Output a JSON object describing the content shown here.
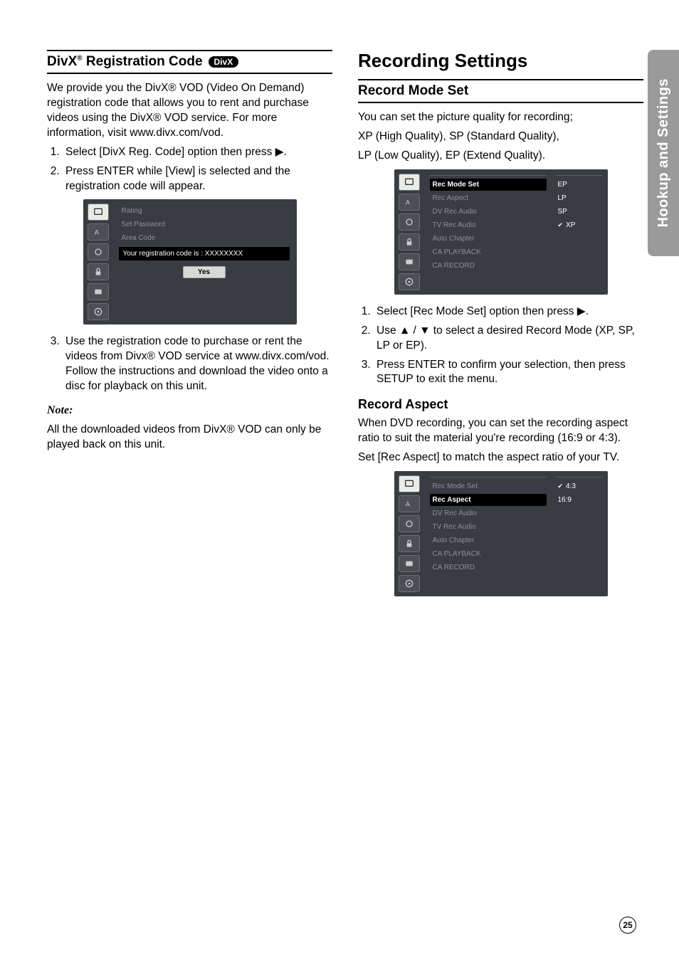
{
  "pageNumber": "25",
  "sideTab": "Hookup and Settings",
  "left": {
    "heading": "DivX® Registration Code",
    "divxBadge": "DivX",
    "intro": "We provide you the DivX® VOD (Video On Demand) registration code that allows you to rent and purchase videos using the DivX® VOD service. For more information, visit www.divx.com/vod.",
    "steps12": {
      "s1": "Select [DivX Reg. Code] option then press ▶.",
      "s2": "Press ENTER while [View] is selected and the registration code will appear."
    },
    "step3": "Use the registration code to purchase or rent the videos from Divx® VOD service at www.divx.com/vod. Follow the instructions and download the video onto a disc for playback on this unit.",
    "noteHead": "Note:",
    "noteBody": "All the downloaded videos from DivX® VOD can only be played back on this unit.",
    "menu": {
      "items": [
        "Rating",
        "Set Password",
        "Area Code"
      ],
      "regLine": "Your registration code is : XXXXXXXX",
      "yes": "Yes"
    }
  },
  "right": {
    "title": "Recording Settings",
    "recModeHead": "Record Mode Set",
    "recModeIntro1": "You can set the picture quality for recording;",
    "recModeIntro2": "XP (High Quality), SP (Standard Quality),",
    "recModeIntro3": "LP (Low Quality), EP (Extend Quality).",
    "menu1": {
      "items": [
        "Rec Mode Set",
        "Rec Aspect",
        "DV Rec Audio",
        "TV Rec Audio",
        "Auto Chapter",
        "CA PLAYBACK",
        "CA RECORD"
      ],
      "selectedIndex": 0,
      "vals": [
        "EP",
        "LP",
        "SP",
        "XP"
      ],
      "checkedVal": "XP"
    },
    "recModeSteps": {
      "s1": "Select [Rec Mode Set] option then press ▶.",
      "s2": "Use ▲ / ▼ to select a desired Record Mode (XP, SP, LP or EP).",
      "s3": "Press ENTER to confirm your selection, then press SETUP to exit the menu."
    },
    "recAspectHead": "Record Aspect",
    "recAspectP1": "When DVD recording, you can set the recording aspect ratio to suit the material you're recording (16:9 or 4:3).",
    "recAspectP2": "Set [Rec Aspect] to match the aspect ratio of your TV.",
    "menu2": {
      "items": [
        "Rec Mode Set",
        "Rec Aspect",
        "DV Rec Audio",
        "TV Rec Audio",
        "Auto Chapter",
        "CA PLAYBACK",
        "CA RECORD"
      ],
      "selectedIndex": 1,
      "vals": [
        "4:3",
        "16:9"
      ],
      "checkedVal": "4:3"
    }
  },
  "chart_data": null
}
